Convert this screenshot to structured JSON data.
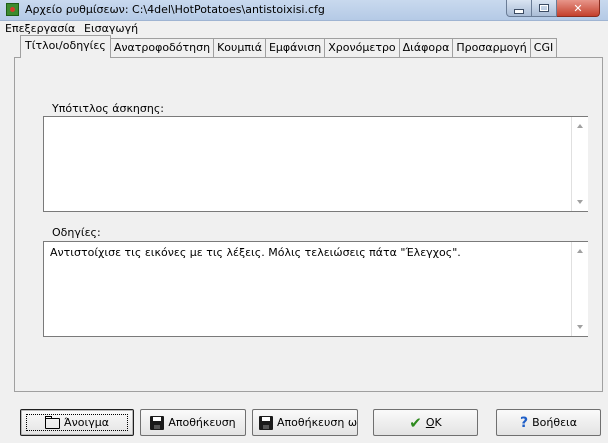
{
  "window": {
    "title": "Αρχείο ρυθμίσεων:  C:\\4del\\HotPotatoes\\antistoixisi.cfg",
    "app_icon": "hotpotatoes-app-icon",
    "controls": [
      "minimize-icon",
      "maximize-icon",
      "close-icon"
    ]
  },
  "menu": {
    "items": [
      "Επεξεργασία",
      "Εισαγωγή"
    ]
  },
  "tabs": {
    "items": [
      "Τίτλοι/οδηγίες",
      "Ανατροφοδότηση",
      "Κουμπιά",
      "Εμφάνιση",
      "Χρονόμετρο",
      "Διάφορα",
      "Προσαρμογή",
      "CGI"
    ],
    "active": "Τίτλοι/οδηγίες"
  },
  "form": {
    "subtitle_label": "Υπότιτλος άσκησης:",
    "subtitle_value": "",
    "instructions_label": "Οδηγίες:",
    "instructions_value": "Αντιστοίχισε τις εικόνες με τις λέξεις. Μόλις τελειώσεις πάτα \"Έλεγχος\"."
  },
  "buttons": {
    "open": {
      "label": "Άνοιγμα",
      "icon": "folder-open-icon"
    },
    "save": {
      "label": "Αποθήκευση",
      "icon": "floppy-disk-icon"
    },
    "save_as": {
      "label": "Αποθήκευση ως",
      "icon": "floppy-disk-save-as-icon"
    },
    "ok": {
      "label_accel": "O",
      "label_rest": "K",
      "icon": "checkmark-icon"
    },
    "help": {
      "label": "Βοήθεια",
      "icon": "question-mark-icon"
    }
  },
  "colors": {
    "titlebar": "#b9cde6",
    "close_button": "#c4402c",
    "face": "#f0f0f0",
    "check_green": "#2e8a1e",
    "help_blue": "#1f5fc8"
  }
}
